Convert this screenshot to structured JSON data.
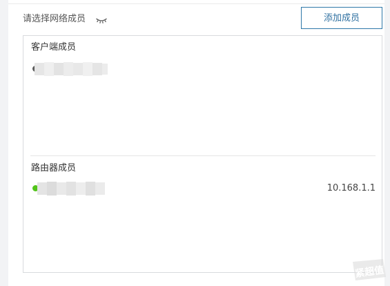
{
  "header": {
    "label": "请选择网络成员",
    "add_button_label": "添加成员"
  },
  "clients": {
    "title": "客户端成员",
    "members": [
      {
        "name_hidden": true,
        "status_color": "#5b5b5b"
      }
    ]
  },
  "routers": {
    "title": "路由器成员",
    "members": [
      {
        "name_hidden": true,
        "status_color": "#52c41a",
        "ip": "10.168.1.1"
      }
    ]
  },
  "watermark": {
    "text": "紧超值"
  },
  "icons": {
    "eye": "eye-closed-icon"
  },
  "colors": {
    "accent": "#2d77a8",
    "online": "#52c41a",
    "offline": "#5b5b5b"
  }
}
